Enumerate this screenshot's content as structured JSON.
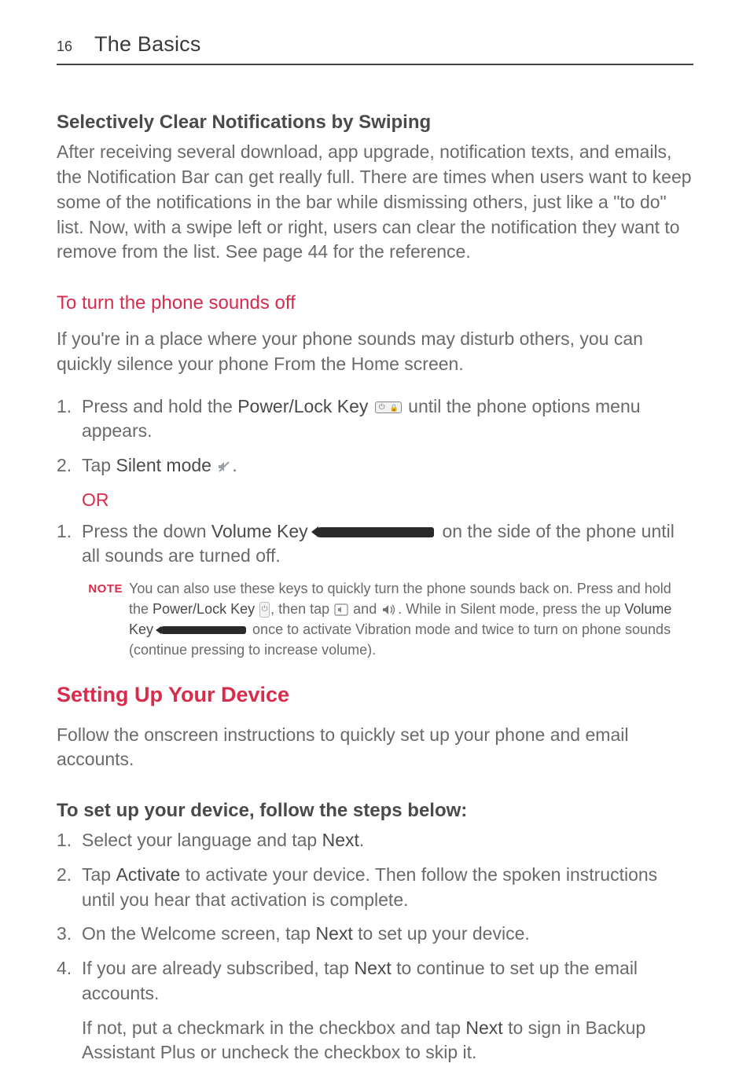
{
  "header": {
    "page_number": "16",
    "chapter": "The Basics"
  },
  "s1": {
    "title": "Selectively Clear Notifications by Swiping",
    "body": "After receiving several download, app upgrade, notification texts, and emails, the Notification Bar can get really full. There are times when users want to keep some of the notifications in the bar while dismissing others, just like a \"to do\" list. Now, with a swipe left or right, users can clear the notification they want to remove from the list. See page 44 for the reference."
  },
  "s2": {
    "title": "To turn the phone sounds off",
    "intro": "If you're in a place where your phone sounds may disturb others, you can quickly silence your phone From the Home screen.",
    "step1_pre": "Press and hold the ",
    "power_lock": "Power/Lock Key",
    "step1_post": " until the phone options menu appears.",
    "step2_pre": "Tap ",
    "silent_mode": "Silent mode",
    "step2_post": ".",
    "or": "OR",
    "alt1_pre": "Press the down ",
    "volume_key": "Volume Key",
    "alt1_post": " on the side of the phone until all sounds are turned off."
  },
  "note": {
    "label": "NOTE",
    "t1": "You can also use these keys to quickly turn the phone sounds back on. Press and hold the ",
    "power_lock": "Power/Lock Key",
    "t2": ", then tap ",
    "t3": " and ",
    "t4": ". While in Silent mode, press the up ",
    "volume_key": "Volume Key",
    "t5": " once to activate Vibration mode and twice to turn on phone sounds (continue pressing to increase volume)."
  },
  "s3": {
    "title": "Setting Up Your Device",
    "intro": "Follow the onscreen instructions to quickly set up your phone and email accounts.",
    "sub": "To set up your device, follow the steps below:",
    "li1_a": "Select your language and tap ",
    "next": "Next",
    "li1_b": ".",
    "li2_a": "Tap ",
    "activate": "Activate",
    "li2_b": " to activate your device. Then follow the spoken instructions until you hear that activation is complete.",
    "li3_a": "On the Welcome screen, tap ",
    "li3_b": " to set up your device.",
    "li4_a": "If you are already subscribed, tap ",
    "li4_b": " to continue to set up the email accounts.",
    "li4_c_a": "If not, put a checkmark in the checkbox and tap ",
    "li4_c_b": " to sign in Backup Assistant Plus or uncheck the checkbox to skip it."
  }
}
